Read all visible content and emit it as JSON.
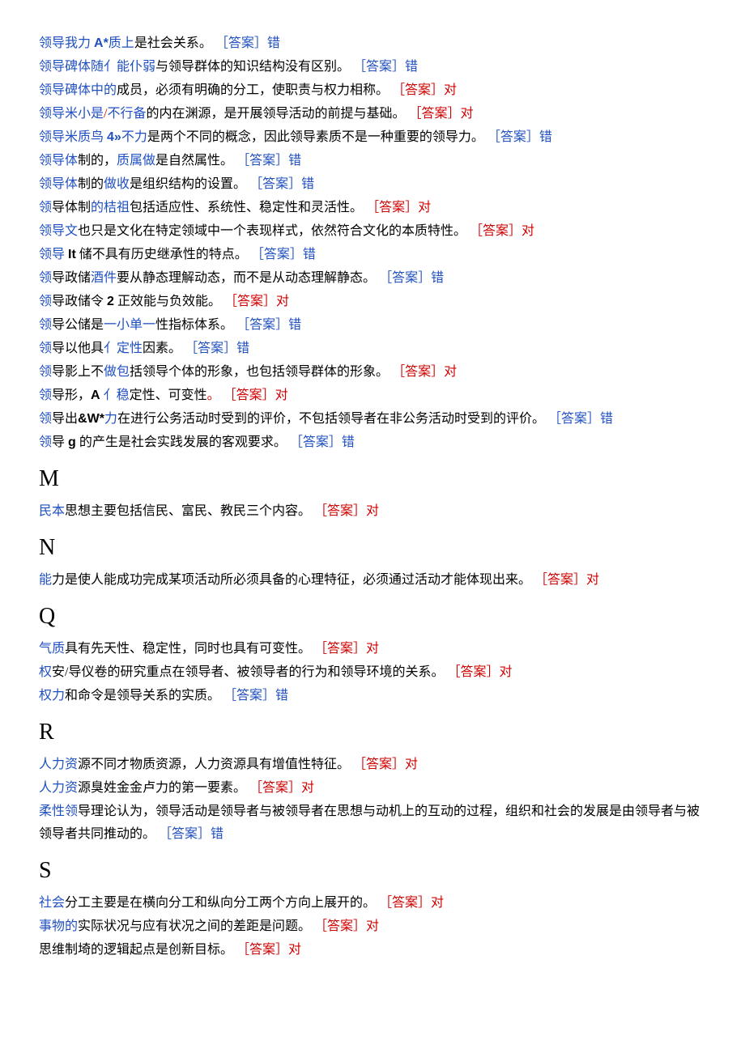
{
  "items": [
    {
      "parts": [
        {
          "t": "领导我力 ",
          "c": "blue"
        },
        {
          "t": "A*",
          "c": "blue serif-inline"
        },
        {
          "t": "质上",
          "c": "blue"
        },
        {
          "t": "是社会关系。 "
        },
        {
          "t": "［答案］错",
          "c": "blue"
        }
      ]
    },
    {
      "parts": [
        {
          "t": "领导碑体随亻能仆弱",
          "c": "blue"
        },
        {
          "t": "与领导群体的知识结构没有区别。 "
        },
        {
          "t": "［答案］错",
          "c": "blue"
        }
      ]
    },
    {
      "parts": [
        {
          "t": "领导碑体中的",
          "c": "blue"
        },
        {
          "t": "成员，必须有明确的分工，使职责与权力相称。 "
        },
        {
          "t": "［答案］对",
          "c": "red"
        }
      ]
    },
    {
      "parts": [
        {
          "t": "领导米小是",
          "c": "blue"
        },
        {
          "t": "/",
          "c": "red"
        },
        {
          "t": "不行备",
          "c": "blue"
        },
        {
          "t": "的内在渊源，是开展领导活动的前提与基础。 "
        },
        {
          "t": "［答案］对",
          "c": "red"
        }
      ]
    },
    {
      "parts": [
        {
          "t": "领导米质鸟 ",
          "c": "blue"
        },
        {
          "t": "4»",
          "c": "blue serif-inline"
        },
        {
          "t": "不力",
          "c": "blue"
        },
        {
          "t": "是两个不同的概念，因此领导素质不是一种重要的领导力。 "
        },
        {
          "t": "［答案］错",
          "c": "blue"
        }
      ]
    },
    {
      "parts": [
        {
          "t": "领导体",
          "c": "blue"
        },
        {
          "t": "制的，"
        },
        {
          "t": "质属做",
          "c": "blue"
        },
        {
          "t": "是自然属性。 "
        },
        {
          "t": "［答案］错",
          "c": "blue"
        }
      ]
    },
    {
      "parts": [
        {
          "t": "领导体",
          "c": "blue"
        },
        {
          "t": "制的"
        },
        {
          "t": "做收",
          "c": "blue"
        },
        {
          "t": "是组织结构的设置。 "
        },
        {
          "t": "［答案］错",
          "c": "blue"
        }
      ]
    },
    {
      "parts": [
        {
          "t": "领",
          "c": "blue"
        },
        {
          "t": "导体制"
        },
        {
          "t": "的桔祖",
          "c": "blue"
        },
        {
          "t": "包括适应性、系统性、稳定性和灵活性。 "
        },
        {
          "t": "［答案］对",
          "c": "red"
        }
      ]
    },
    {
      "parts": [
        {
          "t": "领导文",
          "c": "blue"
        },
        {
          "t": "也只是文化在特定领域中一个表现样式，依然符合文化的本质特性。 "
        },
        {
          "t": "［答案］对",
          "c": "red"
        }
      ]
    },
    {
      "parts": [
        {
          "t": "领导 ",
          "c": "blue"
        },
        {
          "t": "It",
          "c": "serif-inline"
        },
        {
          "t": " 储不具有历史继承性的特点。 "
        },
        {
          "t": "［答案］错",
          "c": "blue"
        }
      ]
    },
    {
      "parts": [
        {
          "t": "领",
          "c": "blue"
        },
        {
          "t": "导政储"
        },
        {
          "t": "酒件",
          "c": "blue"
        },
        {
          "t": "要从静态理解动态，而不是从动态理解静态。 "
        },
        {
          "t": "［答案］错",
          "c": "blue"
        }
      ]
    },
    {
      "parts": [
        {
          "t": "领",
          "c": "blue"
        },
        {
          "t": "导政储令 "
        },
        {
          "t": "2",
          "c": "serif-inline"
        },
        {
          "t": " 正效能与负效能。 "
        },
        {
          "t": "［答案］对",
          "c": "red"
        }
      ]
    },
    {
      "parts": [
        {
          "t": "领",
          "c": "blue"
        },
        {
          "t": "导公储是"
        },
        {
          "t": "一小单一",
          "c": "blue"
        },
        {
          "t": "性指标体系。 "
        },
        {
          "t": "［答案］错",
          "c": "blue"
        }
      ]
    },
    {
      "parts": [
        {
          "t": "领",
          "c": "blue"
        },
        {
          "t": "导以他具"
        },
        {
          "t": "亻定性",
          "c": "blue"
        },
        {
          "t": "因素。 "
        },
        {
          "t": "［答案］错",
          "c": "blue"
        }
      ]
    },
    {
      "parts": [
        {
          "t": "领",
          "c": "blue"
        },
        {
          "t": "导影上不"
        },
        {
          "t": "做包",
          "c": "blue"
        },
        {
          "t": "括领导个体的形象，也包括领导群体的形象。 "
        },
        {
          "t": "［答案］对",
          "c": "red"
        }
      ]
    },
    {
      "parts": [
        {
          "t": "领",
          "c": "blue"
        },
        {
          "t": "导形，"
        },
        {
          "t": "A",
          "c": "serif-inline"
        },
        {
          "t": " 亻稳",
          "c": "blue"
        },
        {
          "t": "定性、可变性"
        },
        {
          "t": "。 ",
          "c": "red"
        },
        {
          "t": "［答案］对",
          "c": "red"
        }
      ]
    },
    {
      "parts": [
        {
          "t": "领",
          "c": "blue"
        },
        {
          "t": "导出"
        },
        {
          "t": "&W*",
          "c": "serif-inline"
        },
        {
          "t": "力",
          "c": "blue"
        },
        {
          "t": "在进行公务活动时受到的评价，不包括领导者在非公务活动时受到的评价。 "
        },
        {
          "t": "［答案］错",
          "c": "blue"
        }
      ]
    },
    {
      "parts": [
        {
          "t": "领",
          "c": "blue"
        },
        {
          "t": "导 "
        },
        {
          "t": "g",
          "c": "serif-inline"
        },
        {
          "t": " 的产生是社会实践发展的客观要求。 "
        },
        {
          "t": "［答案］错",
          "c": "blue"
        }
      ]
    }
  ],
  "letters": {
    "M": "M",
    "N": "N",
    "Q": "Q",
    "R": "R",
    "S": "S"
  },
  "M": [
    {
      "parts": [
        {
          "t": "民本",
          "c": "blue"
        },
        {
          "t": "思想主要包括信民、富民、教民三个内容。 "
        },
        {
          "t": "［答案］对",
          "c": "red"
        }
      ]
    }
  ],
  "N": [
    {
      "parts": [
        {
          "t": "能",
          "c": "blue"
        },
        {
          "t": "力是使人能成功完成某项活动所必须具备的心理特征，必须通过活动才能体现出来。 "
        },
        {
          "t": "［答案］对",
          "c": "red"
        }
      ]
    }
  ],
  "Q": [
    {
      "parts": [
        {
          "t": "气质",
          "c": "blue"
        },
        {
          "t": "具有先天性、稳定性，同时也具有可变性。 "
        },
        {
          "t": "［答案］对",
          "c": "red"
        }
      ]
    },
    {
      "parts": [
        {
          "t": "权",
          "c": "blue"
        },
        {
          "t": "安/导仪卷的研究重点在领导者、被领导者的行为和领导环境的关系。 "
        },
        {
          "t": "［答案］对",
          "c": "red"
        }
      ]
    },
    {
      "parts": [
        {
          "t": "权力",
          "c": "blue"
        },
        {
          "t": "和命令是领导关系的实质。 "
        },
        {
          "t": "［答案］错",
          "c": "blue"
        }
      ]
    }
  ],
  "R": [
    {
      "parts": [
        {
          "t": "人力资",
          "c": "blue"
        },
        {
          "t": "源不同才物质资源，人力资源具有增值性特征。 "
        },
        {
          "t": "［答案］对",
          "c": "red"
        }
      ]
    },
    {
      "parts": [
        {
          "t": "人力资",
          "c": "blue"
        },
        {
          "t": "源臭姓金金卢力的第一要素。 "
        },
        {
          "t": "［答案］对",
          "c": "red"
        }
      ]
    },
    {
      "parts": [
        {
          "t": "柔性领",
          "c": "blue"
        },
        {
          "t": "导理论认为，领导活动是领导者与被领导者在思想与动机上的互动的过程，组织和社会的发展是由领导者与被领导者共同推动的。 "
        },
        {
          "t": "［答案］错",
          "c": "blue"
        }
      ]
    }
  ],
  "S": [
    {
      "parts": [
        {
          "t": "社会",
          "c": "blue"
        },
        {
          "t": "分工主要是在横向分工和纵向分工两个方向上展开的。 "
        },
        {
          "t": "［答案］对",
          "c": "red"
        }
      ]
    },
    {
      "parts": [
        {
          "t": "事物的",
          "c": "blue"
        },
        {
          "t": "实际状况与应有状况之间的差距是问题。 "
        },
        {
          "t": "［答案］对",
          "c": "red"
        }
      ]
    },
    {
      "parts": [
        {
          "t": "思维制埼的逻辑起点是创新目标。 "
        },
        {
          "t": "［答案］对",
          "c": "red"
        }
      ]
    }
  ]
}
